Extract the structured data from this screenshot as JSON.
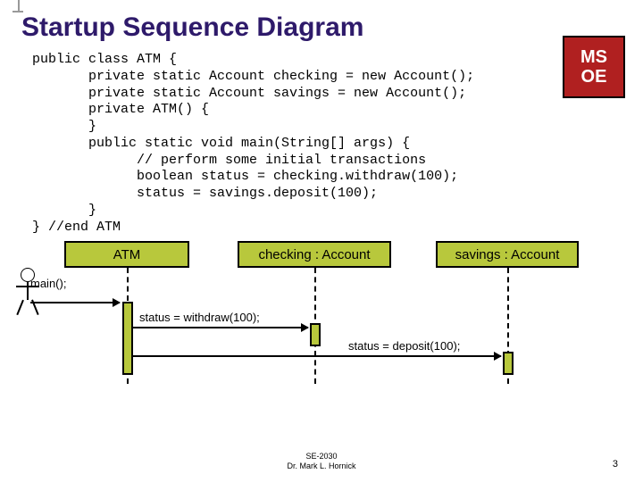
{
  "title": "Startup Sequence Diagram",
  "logo_text": "MS\nOE",
  "code_lines": [
    "public class ATM {",
    "       private static Account checking = new Account();",
    "       private static Account savings = new Account();",
    "       private ATM() {",
    "       }",
    "       public static void main(String[] args) {",
    "             // perform some initial transactions",
    "             boolean status = checking.withdraw(100);",
    "             status = savings.deposit(100);",
    "       }",
    "} //end ATM"
  ],
  "objects": {
    "atm_label": "ATM",
    "checking_label": "checking : Account",
    "savings_label": "savings : Account"
  },
  "messages": {
    "main": "main();",
    "withdraw": "status = withdraw(100);",
    "deposit": "status = deposit(100);"
  },
  "footer": {
    "line1": "SE-2030",
    "line2": "Dr. Mark L. Hornick"
  },
  "page_number": "3"
}
